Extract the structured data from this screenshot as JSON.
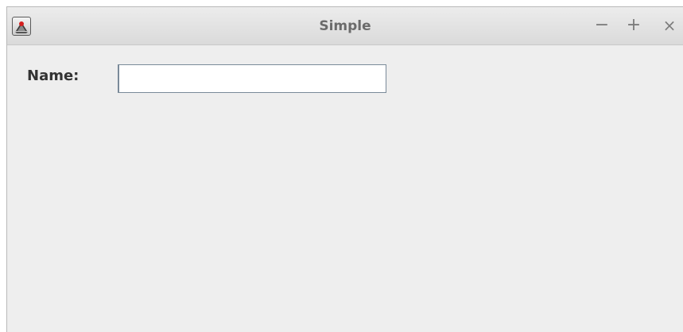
{
  "window": {
    "title": "Simple",
    "app_icon": "java-duke-icon",
    "controls": {
      "minimize_glyph": "−",
      "maximize_glyph": "+",
      "close_glyph": "×"
    }
  },
  "form": {
    "name_label": "Name:",
    "name_value": "",
    "name_placeholder": ""
  },
  "colors": {
    "window_bg": "#eeeeee",
    "titlebar_bg": "#dadada",
    "title_text": "#6b6b6b",
    "label_text": "#333333",
    "input_border": "#7a8a99"
  }
}
